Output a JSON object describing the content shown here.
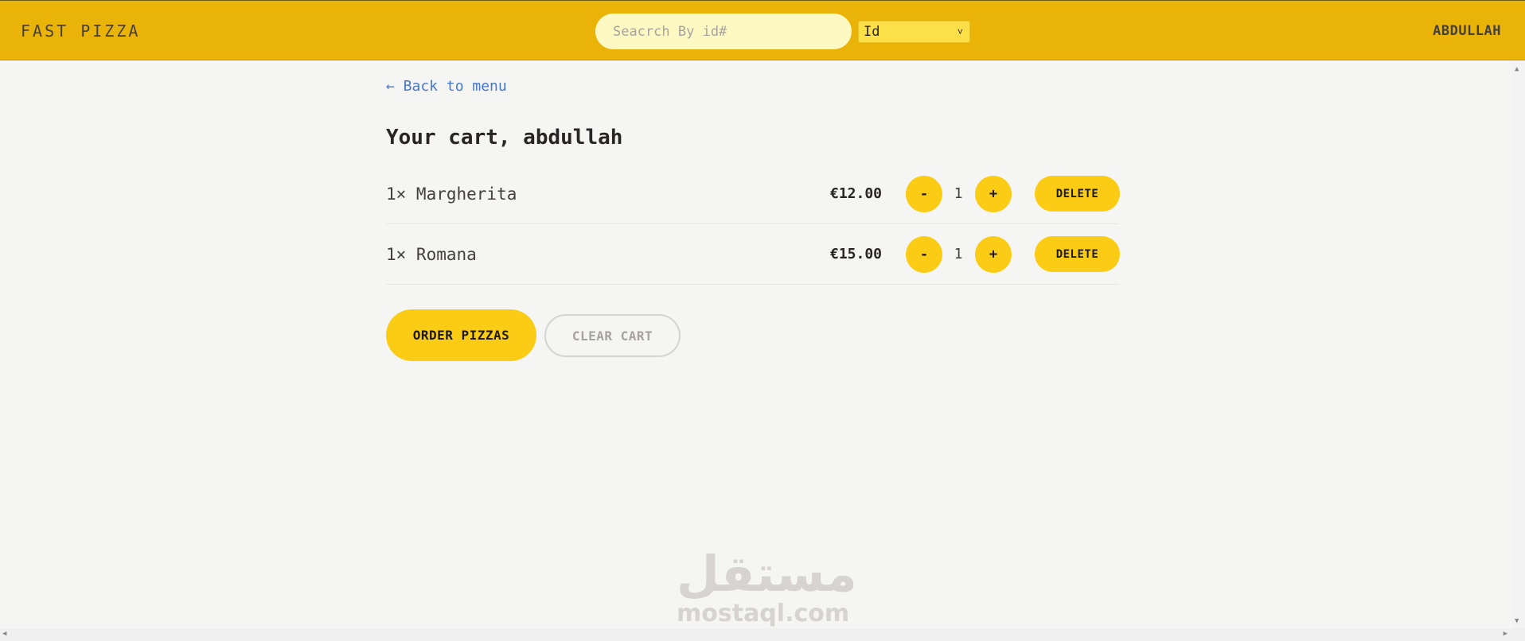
{
  "header": {
    "logo": "FAST PIZZA",
    "search_placeholder": "Seacrch By id#",
    "select_value": "Id",
    "username": "ABDULLAH"
  },
  "page": {
    "back_link": "← Back to menu",
    "title": "Your cart, abdullah"
  },
  "cart": {
    "items": [
      {
        "label": "1× Margherita",
        "price": "€12.00",
        "quantity": "1",
        "minus": "-",
        "plus": "+",
        "delete": "DELETE"
      },
      {
        "label": "1× Romana",
        "price": "€15.00",
        "quantity": "1",
        "minus": "-",
        "plus": "+",
        "delete": "DELETE"
      }
    ],
    "order_button": "ORDER PIZZAS",
    "clear_button": "CLEAR CART"
  },
  "watermark": {
    "arabic": "مستقل",
    "latin": "mostaql.com"
  },
  "colors": {
    "header_bg": "#eab308",
    "accent": "#facc15",
    "search_bg": "#fef9c3",
    "link": "#4477cc"
  }
}
